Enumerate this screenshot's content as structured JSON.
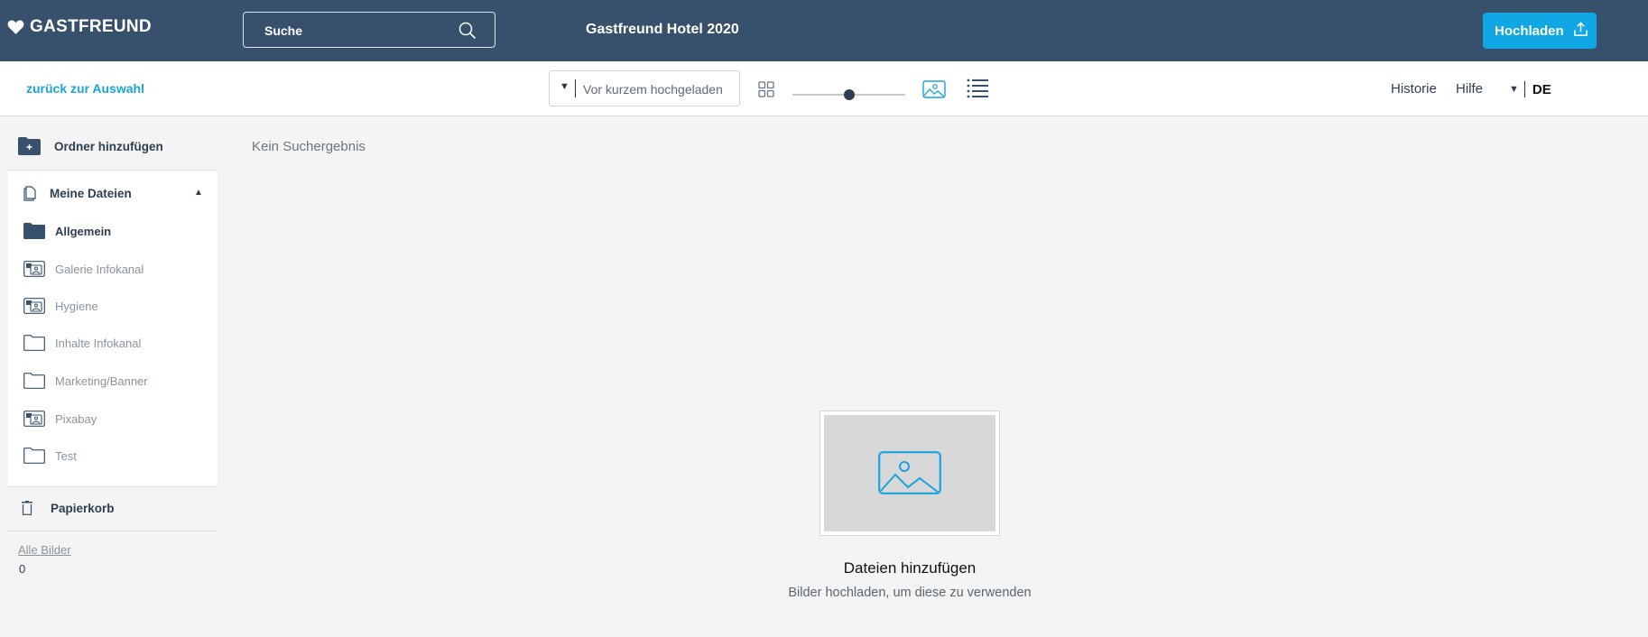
{
  "header": {
    "logo_text": "GASTFREUND",
    "search_placeholder": "Suche",
    "hotel_title": "Gastfreund Hotel 2020",
    "upload_label": "Hochladen"
  },
  "toolbar": {
    "back_label": "zurück zur Auswahl",
    "sort_value": "Vor kurzem hochgeladen",
    "zoom_level": 0.5,
    "historie_label": "Historie",
    "hilfe_label": "Hilfe",
    "language": "DE"
  },
  "sidebar": {
    "add_folder_label": "Ordner hinzufügen",
    "my_files_label": "Meine Dateien",
    "folders": [
      {
        "label": "Allgemein",
        "icon": "folder-filled-icon",
        "active": true
      },
      {
        "label": "Galerie Infokanal",
        "icon": "gallery-folder-icon",
        "active": false
      },
      {
        "label": "Hygiene",
        "icon": "gallery-folder-icon",
        "active": false
      },
      {
        "label": "Inhalte Infokanal",
        "icon": "folder-outline-icon",
        "active": false
      },
      {
        "label": "Marketing/Banner",
        "icon": "folder-outline-icon",
        "active": false
      },
      {
        "label": "Pixabay",
        "icon": "gallery-folder-icon",
        "active": false
      },
      {
        "label": "Test",
        "icon": "folder-outline-icon",
        "active": false
      }
    ],
    "trash_label": "Papierkorb",
    "all_images_label": "Alle Bilder",
    "all_images_count": "0"
  },
  "main": {
    "no_result_text": "Kein Suchergebnis",
    "empty_title": "Dateien hinzufügen",
    "empty_subtitle": "Bilder hochladen, um diese zu verwenden"
  },
  "colors": {
    "header_bg": "#37506b",
    "accent": "#11a7e5",
    "text_dark": "#2d3e50"
  }
}
